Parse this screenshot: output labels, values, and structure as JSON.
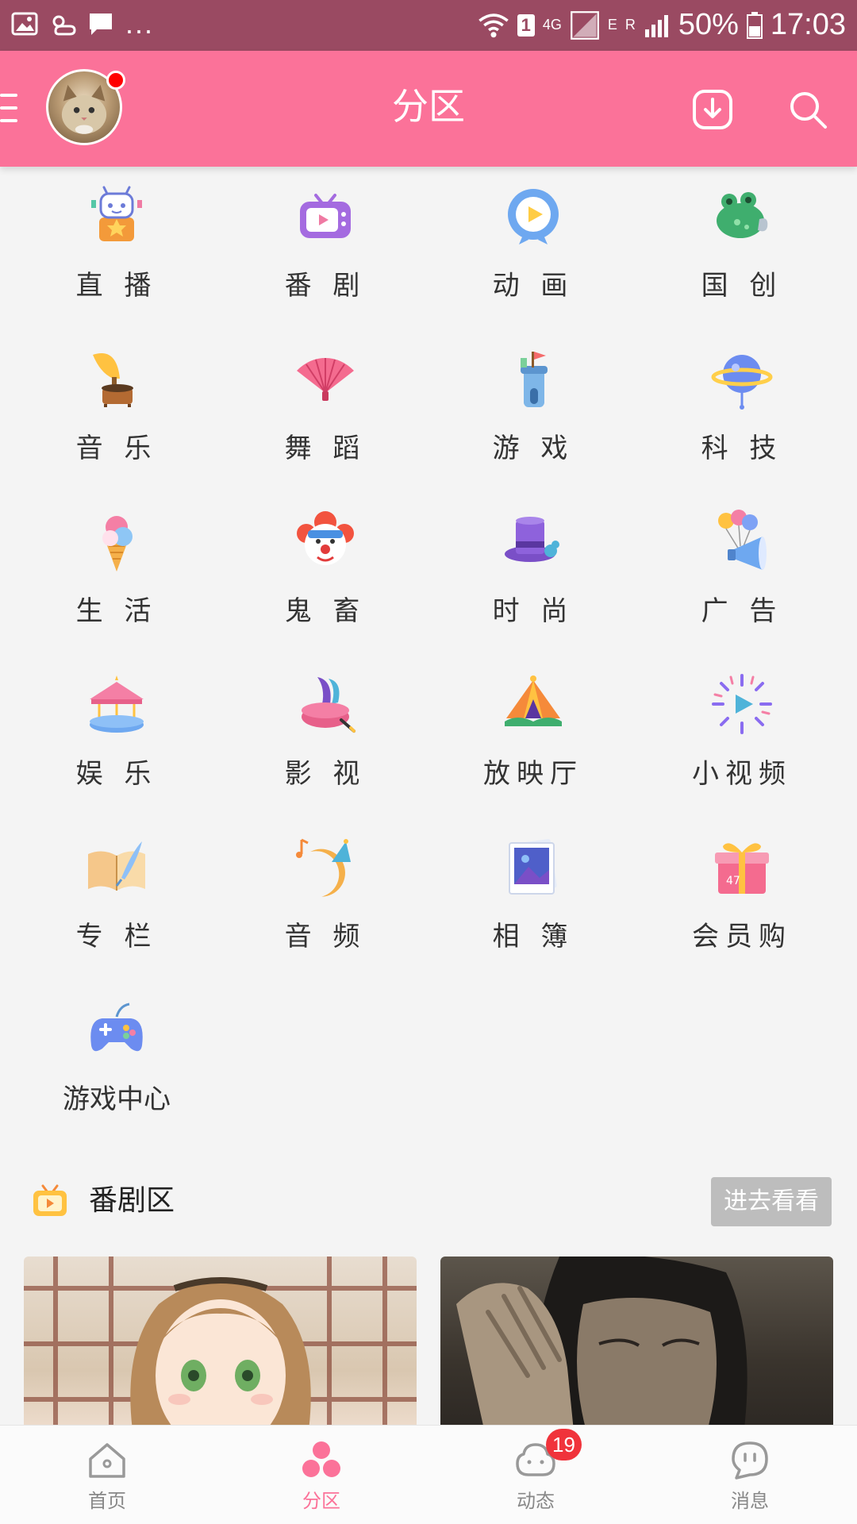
{
  "status_bar": {
    "network": "4G",
    "sim_badge": "1",
    "mobile_tag": "E",
    "roaming_tag": "R",
    "battery": "50%",
    "time": "17:03",
    "overflow": "..."
  },
  "header": {
    "title": "分区"
  },
  "categories": [
    {
      "label": "直 播",
      "icon": "live-robot-icon"
    },
    {
      "label": "番 剧",
      "icon": "tv-icon"
    },
    {
      "label": "动 画",
      "icon": "play-badge-icon"
    },
    {
      "label": "国 创",
      "icon": "frog-icon"
    },
    {
      "label": "音 乐",
      "icon": "gramophone-icon"
    },
    {
      "label": "舞 蹈",
      "icon": "fan-icon"
    },
    {
      "label": "游 戏",
      "icon": "tower-icon"
    },
    {
      "label": "科 技",
      "icon": "planet-icon"
    },
    {
      "label": "生 活",
      "icon": "ice-cream-icon"
    },
    {
      "label": "鬼 畜",
      "icon": "clown-icon"
    },
    {
      "label": "时 尚",
      "icon": "top-hat-icon"
    },
    {
      "label": "广 告",
      "icon": "megaphone-icon"
    },
    {
      "label": "娱 乐",
      "icon": "carousel-icon"
    },
    {
      "label": "影 视",
      "icon": "magic-hat-icon"
    },
    {
      "label": "放映厅",
      "icon": "tent-icon"
    },
    {
      "label": "小视频",
      "icon": "firework-play-icon"
    },
    {
      "label": "专 栏",
      "icon": "book-quill-icon"
    },
    {
      "label": "音 频",
      "icon": "moon-music-icon"
    },
    {
      "label": "相 簿",
      "icon": "photo-icon"
    },
    {
      "label": "会员购",
      "icon": "gift-icon"
    },
    {
      "label": "游戏中心",
      "icon": "gamepad-icon"
    }
  ],
  "section": {
    "title": "番剧区",
    "button": "进去看看"
  },
  "bottom_nav": [
    {
      "label": "首页",
      "icon": "home-icon"
    },
    {
      "label": "分区",
      "icon": "category-icon",
      "active": true
    },
    {
      "label": "动态",
      "icon": "dynamic-icon",
      "badge": "19"
    },
    {
      "label": "消息",
      "icon": "message-icon"
    }
  ],
  "colors": {
    "accent": "#fb7299",
    "status_bar": "#9a4a62",
    "badge": "#f0333b"
  }
}
